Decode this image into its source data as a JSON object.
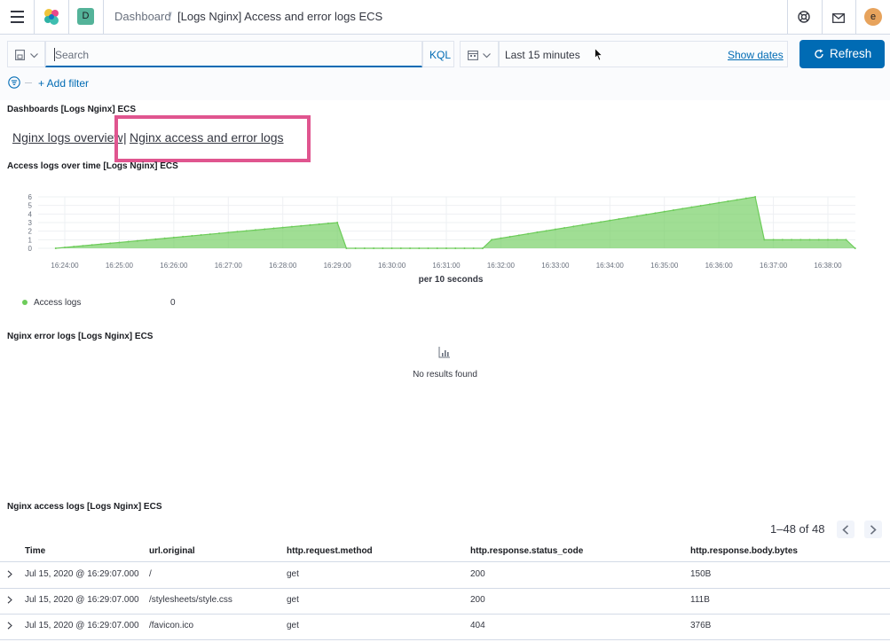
{
  "header": {
    "space_initial": "D",
    "breadcrumb_root": "Dashboard",
    "breadcrumb_sep": "/",
    "breadcrumb_current": "[Logs Nginx] Access and error logs ECS",
    "avatar_initial": "e"
  },
  "query": {
    "search_placeholder": "Search",
    "language": "KQL",
    "time_range": "Last 15 minutes",
    "show_dates": "Show dates",
    "refresh": "Refresh",
    "add_filter": "+ Add filter"
  },
  "panels": {
    "dashboards": {
      "title": "Dashboards [Logs Nginx] ECS",
      "link1": "Nginx logs overview",
      "separator": "|",
      "link2": "Nginx access and error logs"
    },
    "access_over_time": {
      "title": "Access logs over time [Logs Nginx] ECS",
      "legend_label": "Access logs",
      "legend_value": "0"
    },
    "error_logs": {
      "title": "Nginx error logs [Logs Nginx] ECS",
      "empty": "No results found"
    },
    "access_logs": {
      "title": "Nginx access logs [Logs Nginx] ECS",
      "pagination": "1–48 of 48",
      "columns": [
        "Time",
        "url.original",
        "http.request.method",
        "http.response.status_code",
        "http.response.body.bytes"
      ],
      "rows": [
        [
          "Jul 15, 2020 @ 16:29:07.000",
          "/",
          "get",
          "200",
          "150B"
        ],
        [
          "Jul 15, 2020 @ 16:29:07.000",
          "/stylesheets/style.css",
          "get",
          "200",
          "111B"
        ],
        [
          "Jul 15, 2020 @ 16:29:07.000",
          "/favicon.ico",
          "get",
          "404",
          "376B"
        ]
      ]
    }
  },
  "colors": {
    "accent": "#006bb4",
    "highlight": "#e0558f",
    "series": "#6dcc5a"
  },
  "chart_data": {
    "type": "area",
    "xlabel": "per 10 seconds",
    "x_ticks": [
      "16:24:00",
      "16:25:00",
      "16:26:00",
      "16:27:00",
      "16:28:00",
      "16:29:00",
      "16:30:00",
      "16:31:00",
      "16:32:00",
      "16:33:00",
      "16:34:00",
      "16:35:00",
      "16:36:00",
      "16:37:00",
      "16:38:00"
    ],
    "y_ticks": [
      "0",
      "1",
      "2",
      "3",
      "4",
      "5",
      "6"
    ],
    "ylim": [
      0,
      6
    ],
    "grid": true,
    "legend": "bottom-left",
    "series": [
      {
        "name": "Access logs",
        "x": [
          "16:23:50",
          "16:29:00",
          "16:29:10",
          "16:31:40",
          "16:31:50",
          "16:36:40",
          "16:36:50",
          "16:38:20",
          "16:38:30"
        ],
        "values": [
          0,
          3,
          0,
          0,
          1,
          6,
          1,
          1,
          0
        ]
      }
    ]
  }
}
